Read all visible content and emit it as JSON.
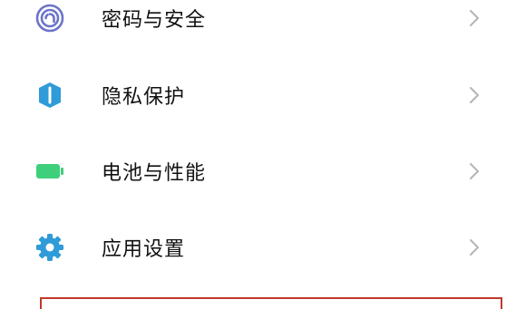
{
  "settings": {
    "items": [
      {
        "label": "密码与安全",
        "icon": "fingerprint-icon",
        "icon_color": "#6b74c9"
      },
      {
        "label": "隐私保护",
        "icon": "shield-icon",
        "icon_color": "#2f9bd9"
      },
      {
        "label": "电池与性能",
        "icon": "battery-icon",
        "icon_color": "#3ecf7a"
      },
      {
        "label": "应用设置",
        "icon": "gear-icon",
        "icon_color": "#2f9bd9"
      }
    ]
  },
  "colors": {
    "chevron": "#b5b5b5",
    "highlight_border": "#c0392b"
  }
}
